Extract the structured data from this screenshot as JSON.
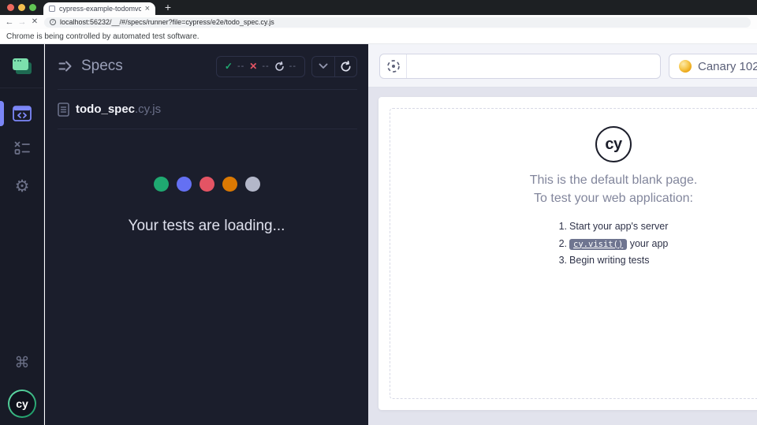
{
  "browser": {
    "tab": {
      "title": "cypress-example-todomvc",
      "close_glyph": "×"
    },
    "new_tab_glyph": "+",
    "nav": {
      "back_glyph": "←",
      "forward_glyph": "→",
      "stop_glyph": "✕"
    },
    "omnibox": {
      "info_glyph": "i",
      "url": "localhost:56232/__/#/specs/runner?file=cypress/e2e/todo_spec.cy.js"
    },
    "banner": "Chrome is being controlled by automated test software.",
    "traffic_colors": {
      "close": "#ed6a5e",
      "minimize": "#f4bf4f",
      "zoom": "#61c554"
    }
  },
  "icons": {
    "gear": "⚙",
    "command": "⌘",
    "check": "✓",
    "cross": "✕"
  },
  "sidebar": {
    "cy_logo_text": "cy"
  },
  "specs": {
    "title": "Specs",
    "stats": {
      "passed": "--",
      "failed": "--",
      "running": "--"
    },
    "spec": {
      "name": "todo_spec",
      "ext": ".cy.js"
    },
    "loading_text": "Your tests are loading...",
    "dot_colors": [
      "#1fa971",
      "#6470f3",
      "#e45464",
      "#db7903",
      "#b3b7c9"
    ],
    "accent_color": "#7b86f6"
  },
  "aut": {
    "url_value": "",
    "browser_selector": {
      "label": "Canary 102"
    },
    "blank_page": {
      "logo_text": "cy",
      "heading_line1": "This is the default blank page.",
      "heading_line2": "To test your web application:",
      "steps": [
        {
          "num": "1.",
          "text": "Start your app's server"
        },
        {
          "num": "2.",
          "code": "cy.visit()",
          "text": " your app"
        },
        {
          "num": "3.",
          "text": "Begin writing tests"
        }
      ]
    }
  }
}
